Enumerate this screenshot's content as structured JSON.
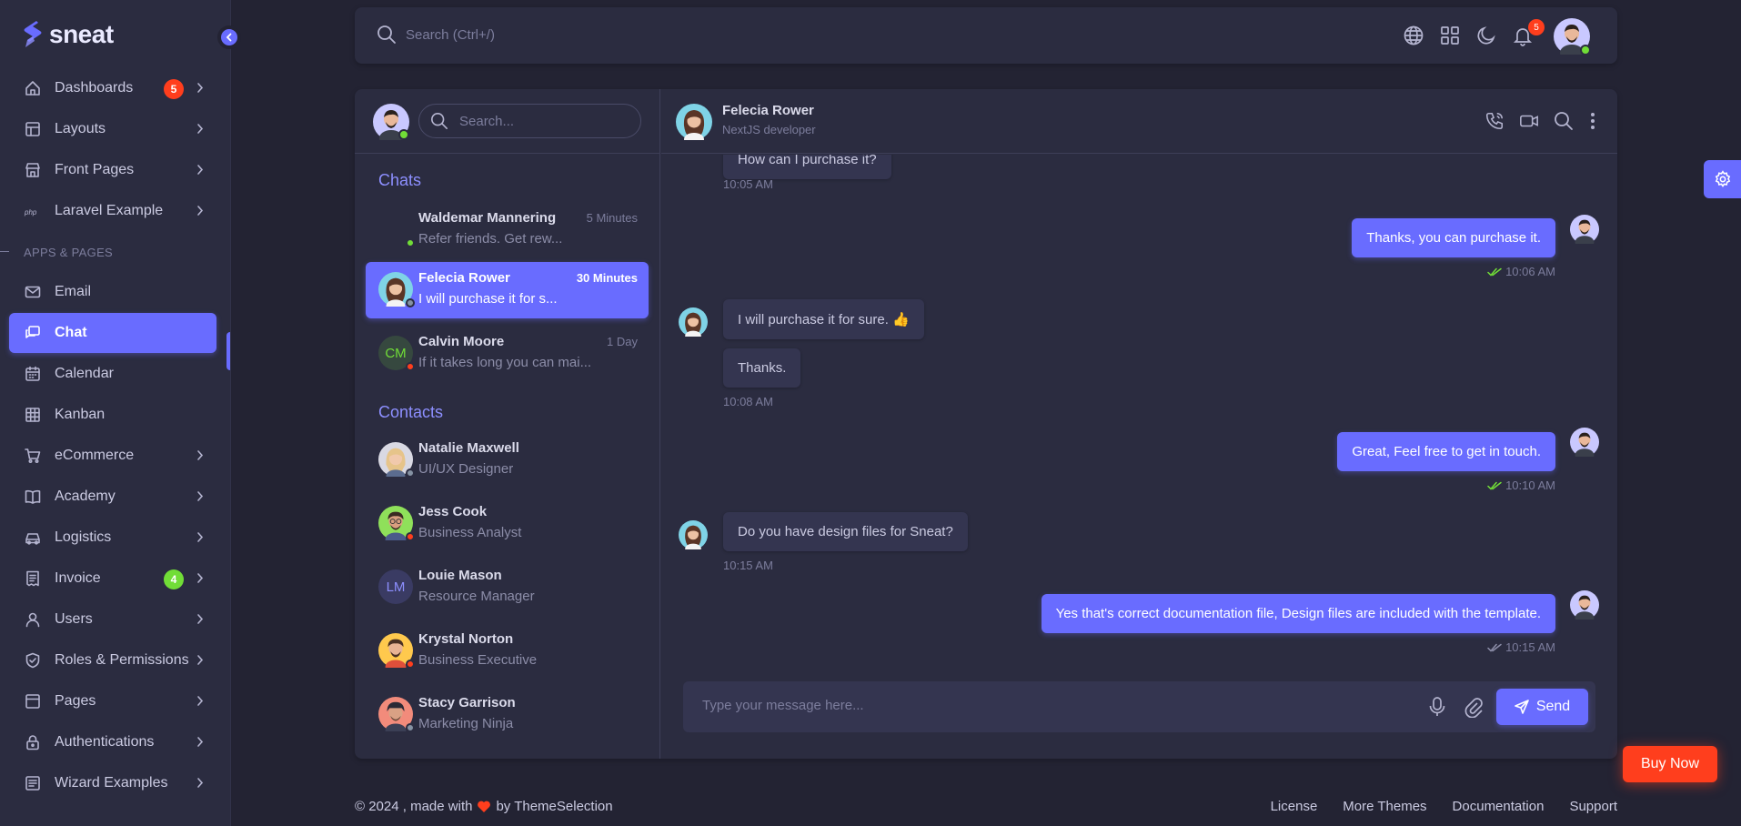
{
  "brand": {
    "name": "sneat"
  },
  "sidebar": {
    "items": [
      {
        "label": "Dashboards",
        "icon": "home-icon",
        "badge": "5",
        "badge_color": "#ff3e1d",
        "chevron": true
      },
      {
        "label": "Layouts",
        "icon": "layout-icon",
        "chevron": true
      },
      {
        "label": "Front Pages",
        "icon": "store-icon",
        "chevron": true
      },
      {
        "label": "Laravel Example",
        "icon": "php-icon",
        "chevron": true
      }
    ],
    "section_header": "APPS & PAGES",
    "app_items": [
      {
        "label": "Email",
        "icon": "mail-icon",
        "chevron": false
      },
      {
        "label": "Chat",
        "icon": "chat-icon",
        "chevron": false,
        "active": true
      },
      {
        "label": "Calendar",
        "icon": "calendar-icon",
        "chevron": false
      },
      {
        "label": "Kanban",
        "icon": "grid-icon",
        "chevron": false
      },
      {
        "label": "eCommerce",
        "icon": "cart-icon",
        "chevron": true
      },
      {
        "label": "Academy",
        "icon": "book-icon",
        "chevron": true
      },
      {
        "label": "Logistics",
        "icon": "car-icon",
        "chevron": true
      },
      {
        "label": "Invoice",
        "icon": "invoice-icon",
        "badge": "4",
        "badge_color": "#71dd37",
        "chevron": true
      },
      {
        "label": "Users",
        "icon": "user-icon",
        "chevron": true
      },
      {
        "label": "Roles & Permissions",
        "icon": "shield-icon",
        "chevron": true
      },
      {
        "label": "Pages",
        "icon": "pages-icon",
        "chevron": true
      },
      {
        "label": "Authentications",
        "icon": "lock-icon",
        "chevron": true
      },
      {
        "label": "Wizard Examples",
        "icon": "wizard-icon",
        "chevron": true
      }
    ]
  },
  "navbar": {
    "search_placeholder": "Search (Ctrl+/)",
    "notification_count": "5"
  },
  "chat_list": {
    "search_placeholder": "Search...",
    "chats_title": "Chats",
    "contacts_title": "Contacts",
    "chats": [
      {
        "name": "Waldemar Mannering",
        "preview": "Refer friends. Get rew...",
        "time": "5 Minutes",
        "status": "online"
      },
      {
        "name": "Felecia Rower",
        "preview": "I will purchase it for s...",
        "time": "30 Minutes",
        "status": "offline",
        "active": true
      },
      {
        "name": "Calvin Moore",
        "preview": "If it takes long you can mai...",
        "time": "1 Day",
        "initials": "CM",
        "status": "busy"
      }
    ],
    "contacts": [
      {
        "name": "Natalie Maxwell",
        "role": "UI/UX Designer",
        "status": "offline"
      },
      {
        "name": "Jess Cook",
        "role": "Business Analyst",
        "status": "busy"
      },
      {
        "name": "Louie Mason",
        "role": "Resource Manager",
        "initials": "LM"
      },
      {
        "name": "Krystal Norton",
        "role": "Business Executive",
        "status": "busy"
      },
      {
        "name": "Stacy Garrison",
        "role": "Marketing Ninja",
        "status": "offline"
      }
    ]
  },
  "conversation": {
    "name": "Felecia Rower",
    "role": "NextJS developer",
    "messages": [
      {
        "dir": "in",
        "text": "How can I purchase it?",
        "time": "10:05 AM"
      },
      {
        "dir": "out",
        "text": "Thanks, you can purchase it.",
        "time": "10:06 AM",
        "read": true
      },
      {
        "dir": "in",
        "text": "I will purchase it for sure. 👍",
        "time": ""
      },
      {
        "dir": "in",
        "text": "Thanks.",
        "time": "10:08 AM"
      },
      {
        "dir": "out",
        "text": "Great, Feel free to get in touch.",
        "time": "10:10 AM",
        "read": true
      },
      {
        "dir": "in",
        "text": "Do you have design files for Sneat?",
        "time": "10:15 AM"
      },
      {
        "dir": "out",
        "text": "Yes that's correct documentation file, Design files are included with the template.",
        "time": "10:15 AM",
        "read": false
      }
    ],
    "input_placeholder": "Type your message here...",
    "send_label": "Send"
  },
  "footer": {
    "copyright_pre": "© 2024 , made with",
    "copyright_post": "by ThemeSelection",
    "links": [
      "License",
      "More Themes",
      "Documentation",
      "Support"
    ]
  },
  "buy_now_label": "Buy Now",
  "colors": {
    "accent": "#696cff",
    "danger": "#ff3e1d",
    "success": "#71dd37",
    "bg": "#232333",
    "card": "#2b2c40"
  }
}
